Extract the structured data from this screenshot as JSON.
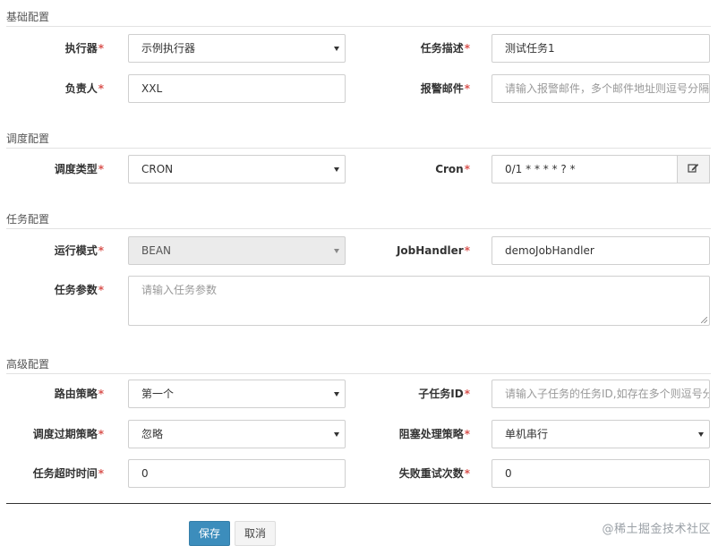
{
  "sections": {
    "basic": "基础配置",
    "schedule": "调度配置",
    "task": "任务配置",
    "advanced": "高级配置"
  },
  "fields": {
    "executor": {
      "label": "执行器",
      "value": "示例执行器"
    },
    "job_desc": {
      "label": "任务描述",
      "value": "测试任务1"
    },
    "author": {
      "label": "负责人",
      "value": "XXL"
    },
    "alarm_email": {
      "label": "报警邮件",
      "placeholder": "请输入报警邮件，多个邮件地址则逗号分隔"
    },
    "schedule_type": {
      "label": "调度类型",
      "value": "CRON"
    },
    "cron": {
      "label": "Cron",
      "value": "0/1 * * * * ? *"
    },
    "glue_type": {
      "label": "运行模式",
      "value": "BEAN"
    },
    "job_handler": {
      "label": "JobHandler",
      "value": "demoJobHandler"
    },
    "job_param": {
      "label": "任务参数",
      "placeholder": "请输入任务参数"
    },
    "route_strategy": {
      "label": "路由策略",
      "value": "第一个"
    },
    "child_job_id": {
      "label": "子任务ID",
      "placeholder": "请输入子任务的任务ID,如存在多个则逗号分隔"
    },
    "misfire_strategy": {
      "label": "调度过期策略",
      "value": "忽略"
    },
    "block_strategy": {
      "label": "阻塞处理策略",
      "value": "单机串行"
    },
    "timeout": {
      "label": "任务超时时间",
      "value": "0"
    },
    "fail_retry": {
      "label": "失败重试次数",
      "value": "0"
    }
  },
  "required_mark": "*",
  "buttons": {
    "save": "保存",
    "cancel": "取消"
  },
  "watermark": "@稀土掘金技术社区",
  "icons": {
    "cron_edit": "edit-icon"
  },
  "colors": {
    "primary": "#3c8dbc",
    "required": "#d9534f"
  }
}
